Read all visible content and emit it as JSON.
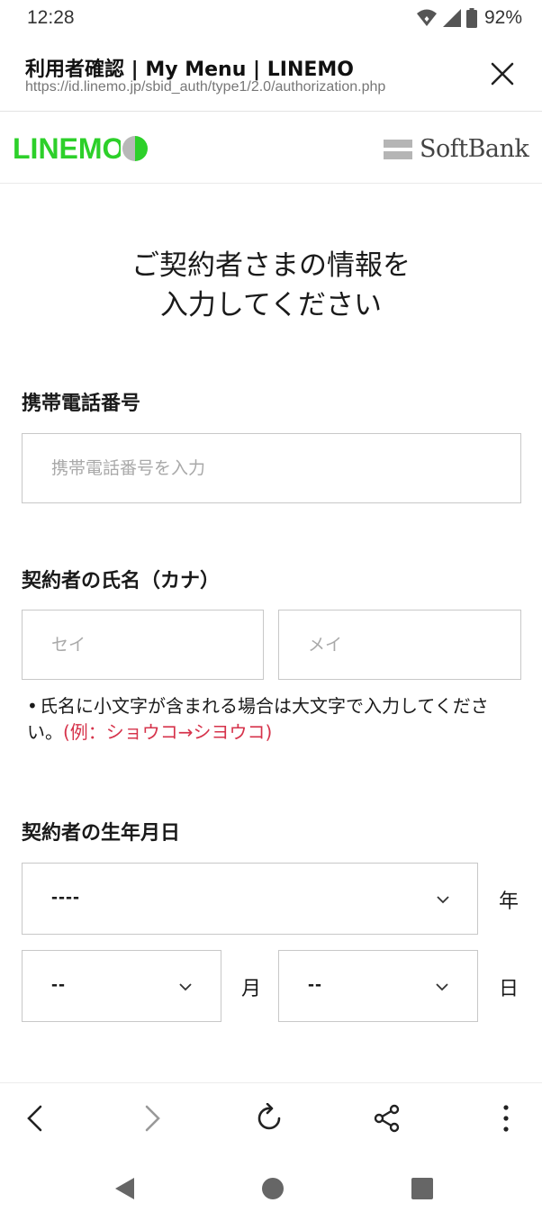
{
  "status_bar": {
    "time": "12:28",
    "battery_percent": "92%",
    "icons": [
      "wifi-icon",
      "signal-icon",
      "battery-icon"
    ]
  },
  "tab": {
    "title": "利用者確認 | My Menu | LINEMO",
    "url": "https://id.linemo.jp/sbid_auth/type1/2.0/authorization.php",
    "close_icon": "close-icon"
  },
  "header": {
    "left_logo": "LINEMO",
    "right_logo": "SoftBank",
    "brand_green": "#2dd02a"
  },
  "main": {
    "title_line1": "ご契約者さまの情報を",
    "title_line2": "入力してください",
    "phone": {
      "label": "携帯電話番号",
      "placeholder": "携帯電話番号を入力",
      "value": ""
    },
    "name_kana": {
      "label": "契約者の氏名（カナ）",
      "sei_placeholder": "セイ",
      "mei_placeholder": "メイ",
      "note_text": "氏名に小文字が含まれる場合は大文字で入力してください。",
      "note_example": "(例：ショウコ→シヨウコ)",
      "example_color": "#d6334b"
    },
    "birthdate": {
      "label": "契約者の生年月日",
      "year_value": "----",
      "year_unit": "年",
      "month_value": "--",
      "month_unit": "月",
      "day_value": "--",
      "day_unit": "日"
    }
  },
  "browser_toolbar": {
    "buttons": [
      "back-icon",
      "forward-icon",
      "reload-icon",
      "share-icon",
      "more-icon"
    ]
  },
  "nav_bar": {
    "buttons": [
      "nav-back-icon",
      "nav-home-icon",
      "nav-recents-icon"
    ]
  }
}
